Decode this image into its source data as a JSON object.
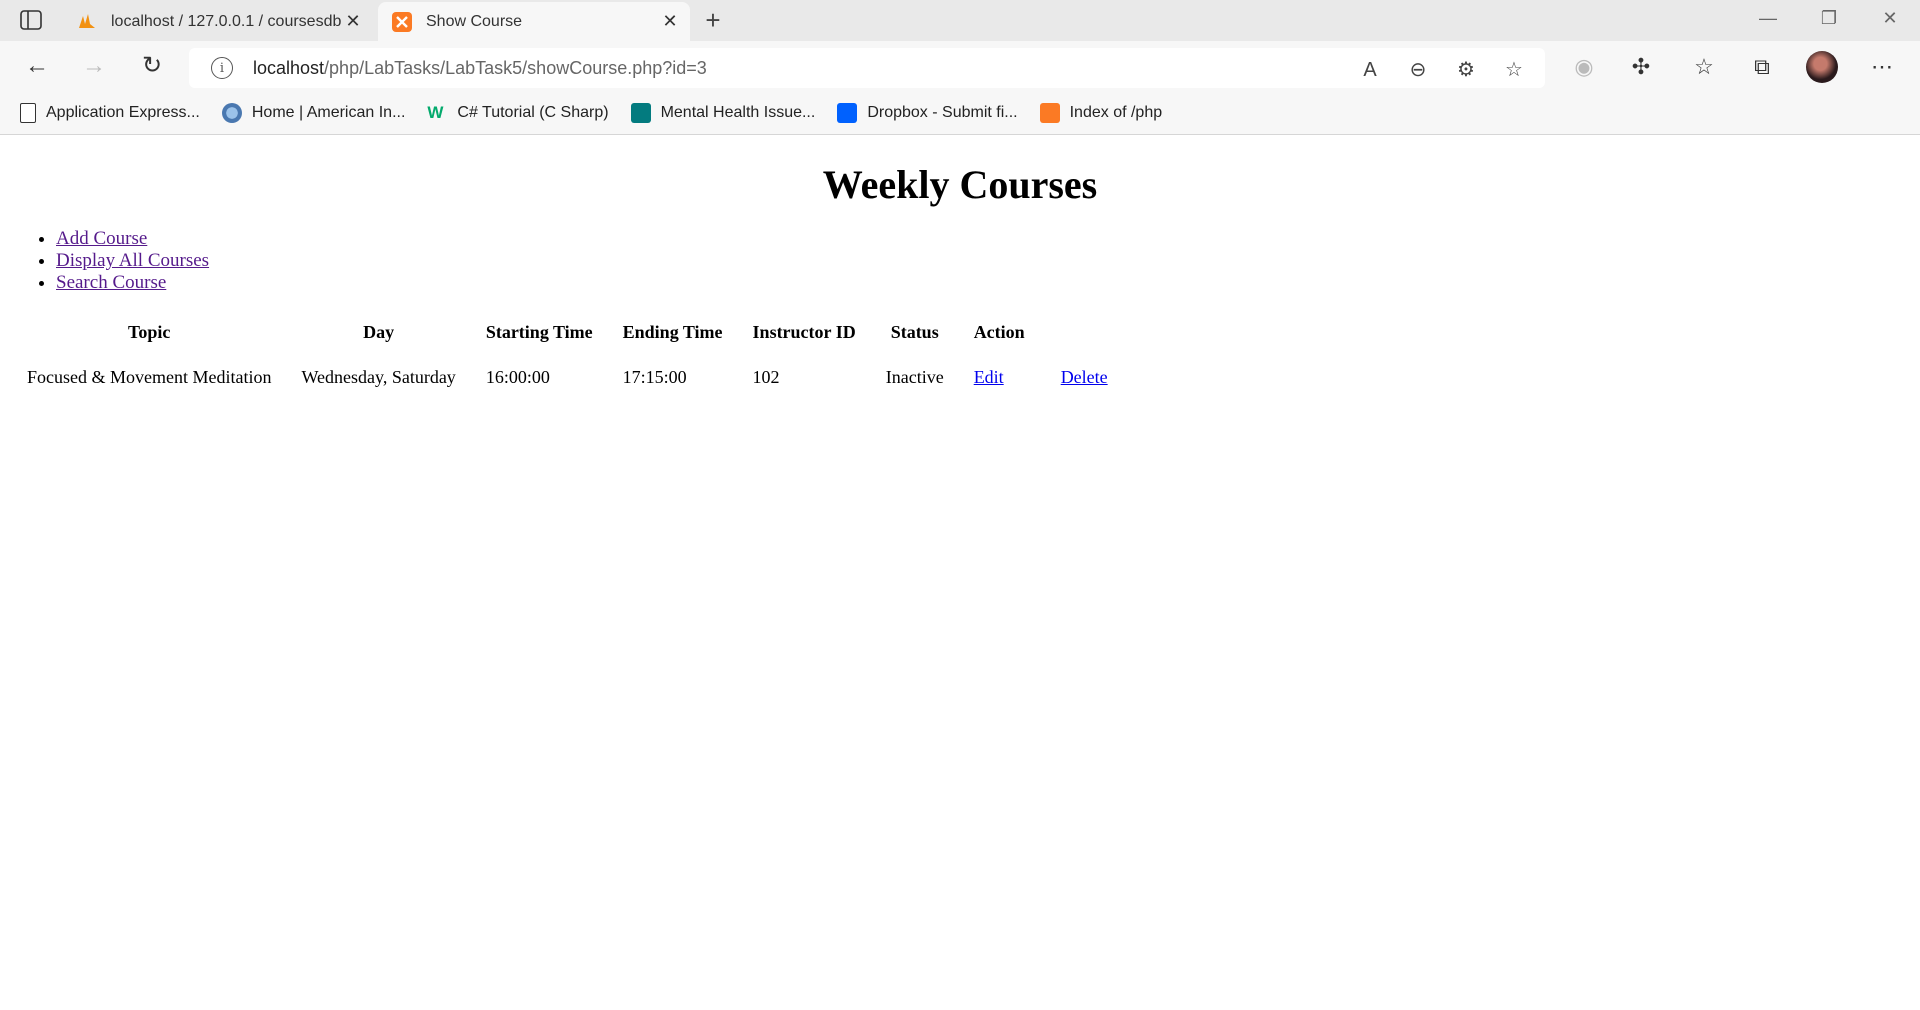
{
  "browser": {
    "tabs": [
      {
        "title": "localhost / 127.0.0.1 / coursesdb",
        "active": false
      },
      {
        "title": "Show Course",
        "active": true
      }
    ],
    "url_host": "localhost",
    "url_path": "/php/LabTasks/LabTask5/showCourse.php?id=3",
    "bookmarks": [
      "Application Express...",
      "Home | American In...",
      "C# Tutorial (C Sharp)",
      "Mental Health Issue...",
      "Dropbox - Submit fi...",
      "Index of /php"
    ]
  },
  "page": {
    "title": "Weekly Courses",
    "nav": [
      "Add Course",
      "Display All Courses",
      "Search Course"
    ],
    "table": {
      "headers": [
        "Topic",
        "Day",
        "Starting Time",
        "Ending Time",
        "Instructor ID",
        "Status",
        "Action"
      ],
      "rows": [
        {
          "topic": "Focused & Movement Meditation",
          "day": "Wednesday, Saturday",
          "start": "16:00:00",
          "end": "17:15:00",
          "instructor": "102",
          "status": "Inactive",
          "edit": "Edit",
          "delete": "Delete"
        }
      ]
    }
  },
  "colors": {
    "link": "#0000ee",
    "visited_link": "#551a8b",
    "chrome_bg": "#e9e9e9"
  }
}
